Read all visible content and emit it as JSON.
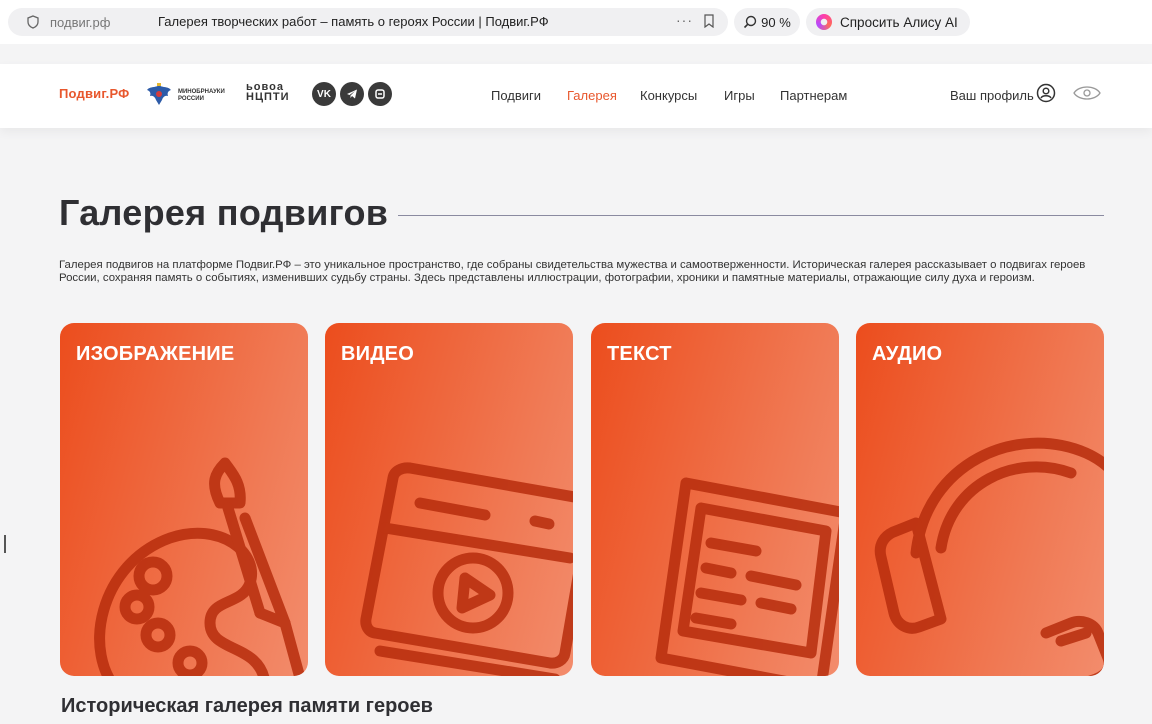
{
  "browser": {
    "domain": "подвиг.рф",
    "page_title": "Галерея творческих работ – память о героях России | Подвиг.РФ",
    "zoom": "90 %",
    "alice_label": "Спросить Алису AI"
  },
  "header": {
    "logo": "Подвиг.РФ",
    "ministry_line1": "МИНОБРНАУКИ",
    "ministry_line2": "РОССИИ",
    "partner_line1": "ьовоа",
    "partner_line2": "НЦПТИ",
    "social": [
      "VK",
      "TG",
      "OK"
    ],
    "nav": [
      {
        "label": "Подвиги"
      },
      {
        "label": "Галерея"
      },
      {
        "label": "Конкурсы"
      },
      {
        "label": "Игры"
      },
      {
        "label": "Партнерам"
      }
    ],
    "profile_label": "Ваш профиль"
  },
  "main": {
    "title": "Галерея подвигов",
    "intro": "Галерея подвигов на платформе Подвиг.РФ – это уникальное пространство, где собраны свидетельства мужества и самоотверженности. Историческая галерея рассказывает о подвигах героев России, сохраняя память о событиях, изменивших судьбу страны. Здесь представлены иллюстрации, фотографии, хроники и памятные материалы, отражающие силу духа и героизм.",
    "cards": [
      {
        "label": "ИЗОБРАЖЕНИЕ",
        "icon": "palette-icon"
      },
      {
        "label": "ВИДЕО",
        "icon": "video-player-icon"
      },
      {
        "label": "ТЕКСТ",
        "icon": "document-icon"
      },
      {
        "label": "АУДИО",
        "icon": "headphones-icon"
      }
    ],
    "section_title": "Историческая галерея памяти героев"
  },
  "colors": {
    "accent": "#e8572d",
    "card_start": "#ec4d1d",
    "card_end": "#f38c6c",
    "background": "#f4f4f5"
  }
}
